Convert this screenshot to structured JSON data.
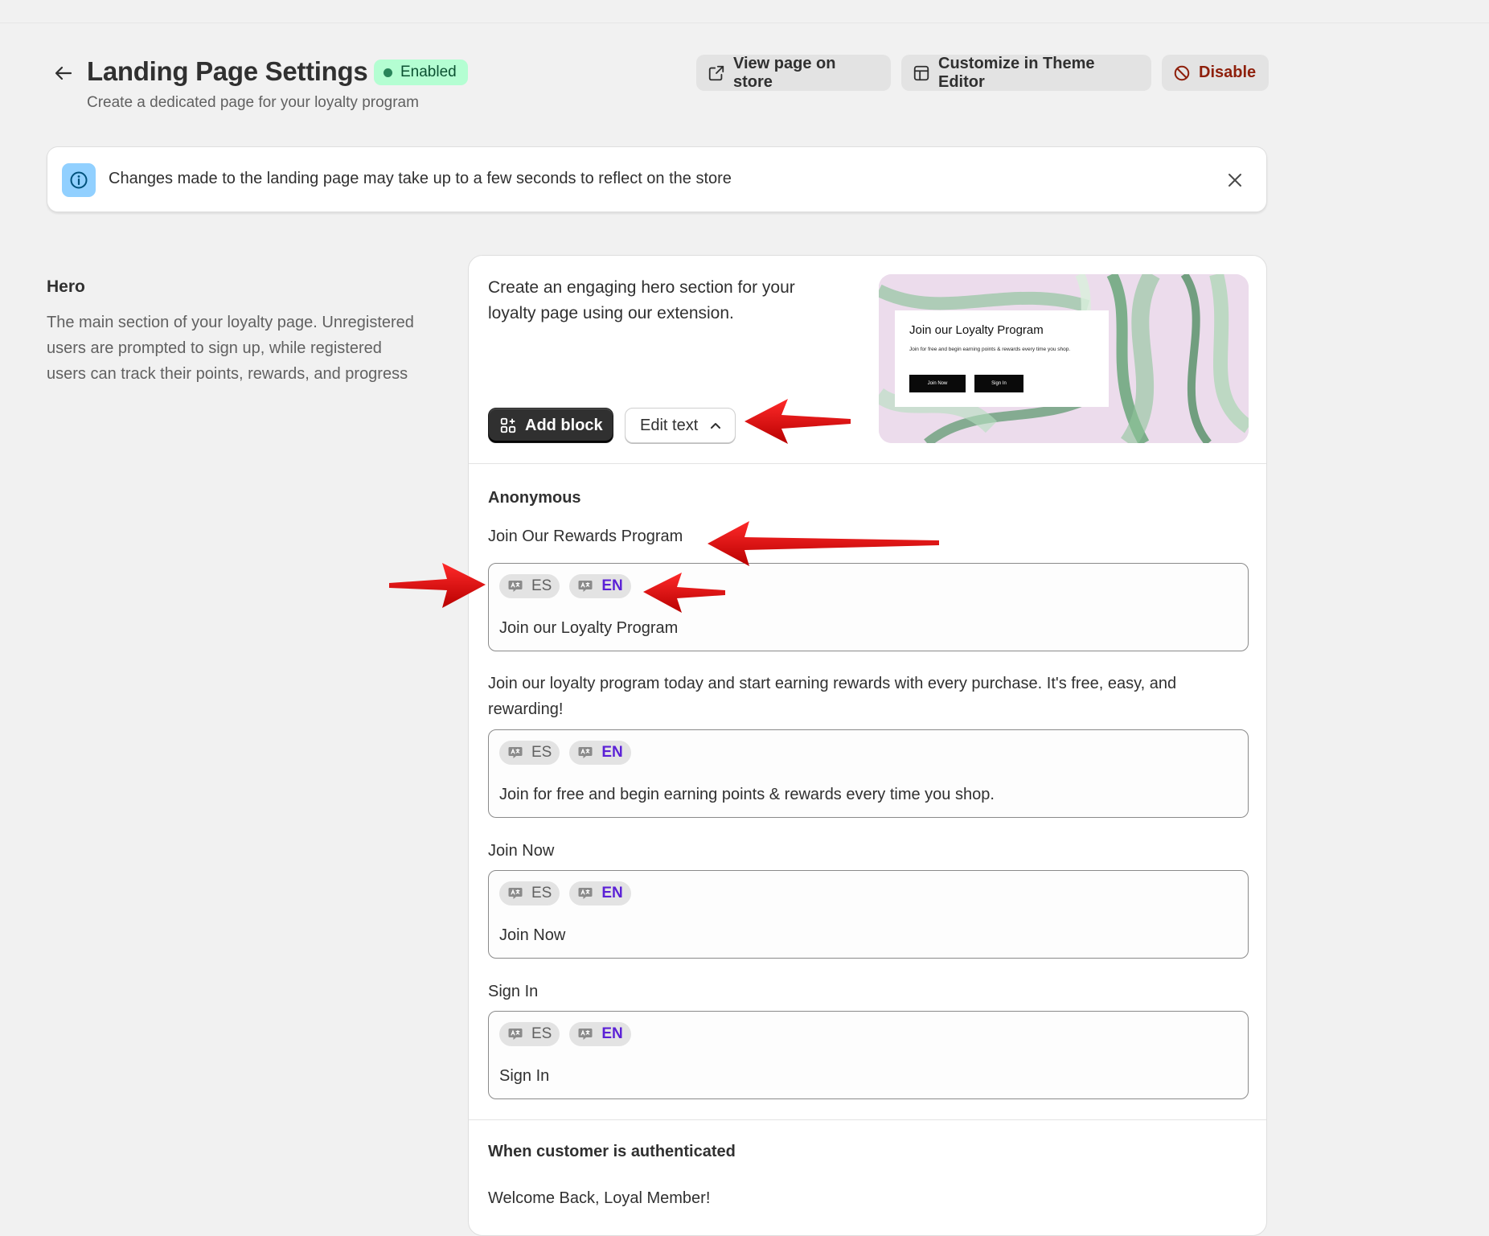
{
  "header": {
    "title": "Landing Page Settings",
    "status": "Enabled",
    "subtitle": "Create a dedicated page for your loyalty program",
    "actions": {
      "view": "View page on store",
      "customize": "Customize in Theme Editor",
      "disable": "Disable"
    }
  },
  "banner": {
    "message": "Changes made to the landing page may take up to a few seconds to reflect on the store"
  },
  "section": {
    "title": "Hero",
    "description": "The main section of your loyalty page. Unregistered users are prompted to sign up, while registered users can track their points, rewards, and progress"
  },
  "hero_card": {
    "intro": "Create an engaging hero section for your loyalty page using our extension.",
    "add_block": "Add block",
    "edit_text": "Edit text",
    "preview": {
      "title": "Join our Loyalty Program",
      "text": "Join for free and begin earning points & rewards every time you shop.",
      "join_btn": "Join Now",
      "signin_btn": "Sign In"
    }
  },
  "languages": {
    "es": "ES",
    "en": "EN"
  },
  "anonymous": {
    "heading": "Anonymous",
    "fields": [
      {
        "label": "Join Our Rewards Program",
        "value": "Join our Loyalty Program"
      },
      {
        "label": "Join our loyalty program today and start earning rewards with every purchase. It's free, easy, and rewarding!",
        "value": "Join for free and begin earning points & rewards every time you shop."
      },
      {
        "label": "Join Now",
        "value": "Join Now"
      },
      {
        "label": "Sign In",
        "value": "Sign In"
      }
    ]
  },
  "authenticated": {
    "heading": "When customer is authenticated",
    "first_label": "Welcome Back, Loyal Member!"
  },
  "colors": {
    "background": "#f1f1f1",
    "badge_bg": "#b4fed2",
    "active_language": "#5b21d6",
    "disable_text": "#8e1f0b",
    "annotation_arrow": "#e30613"
  },
  "icons": [
    "back-arrow-icon",
    "external-link-icon",
    "layout-icon",
    "disable-icon",
    "info-icon",
    "close-icon",
    "add-block-icon",
    "chevron-up-icon",
    "translate-icon"
  ]
}
